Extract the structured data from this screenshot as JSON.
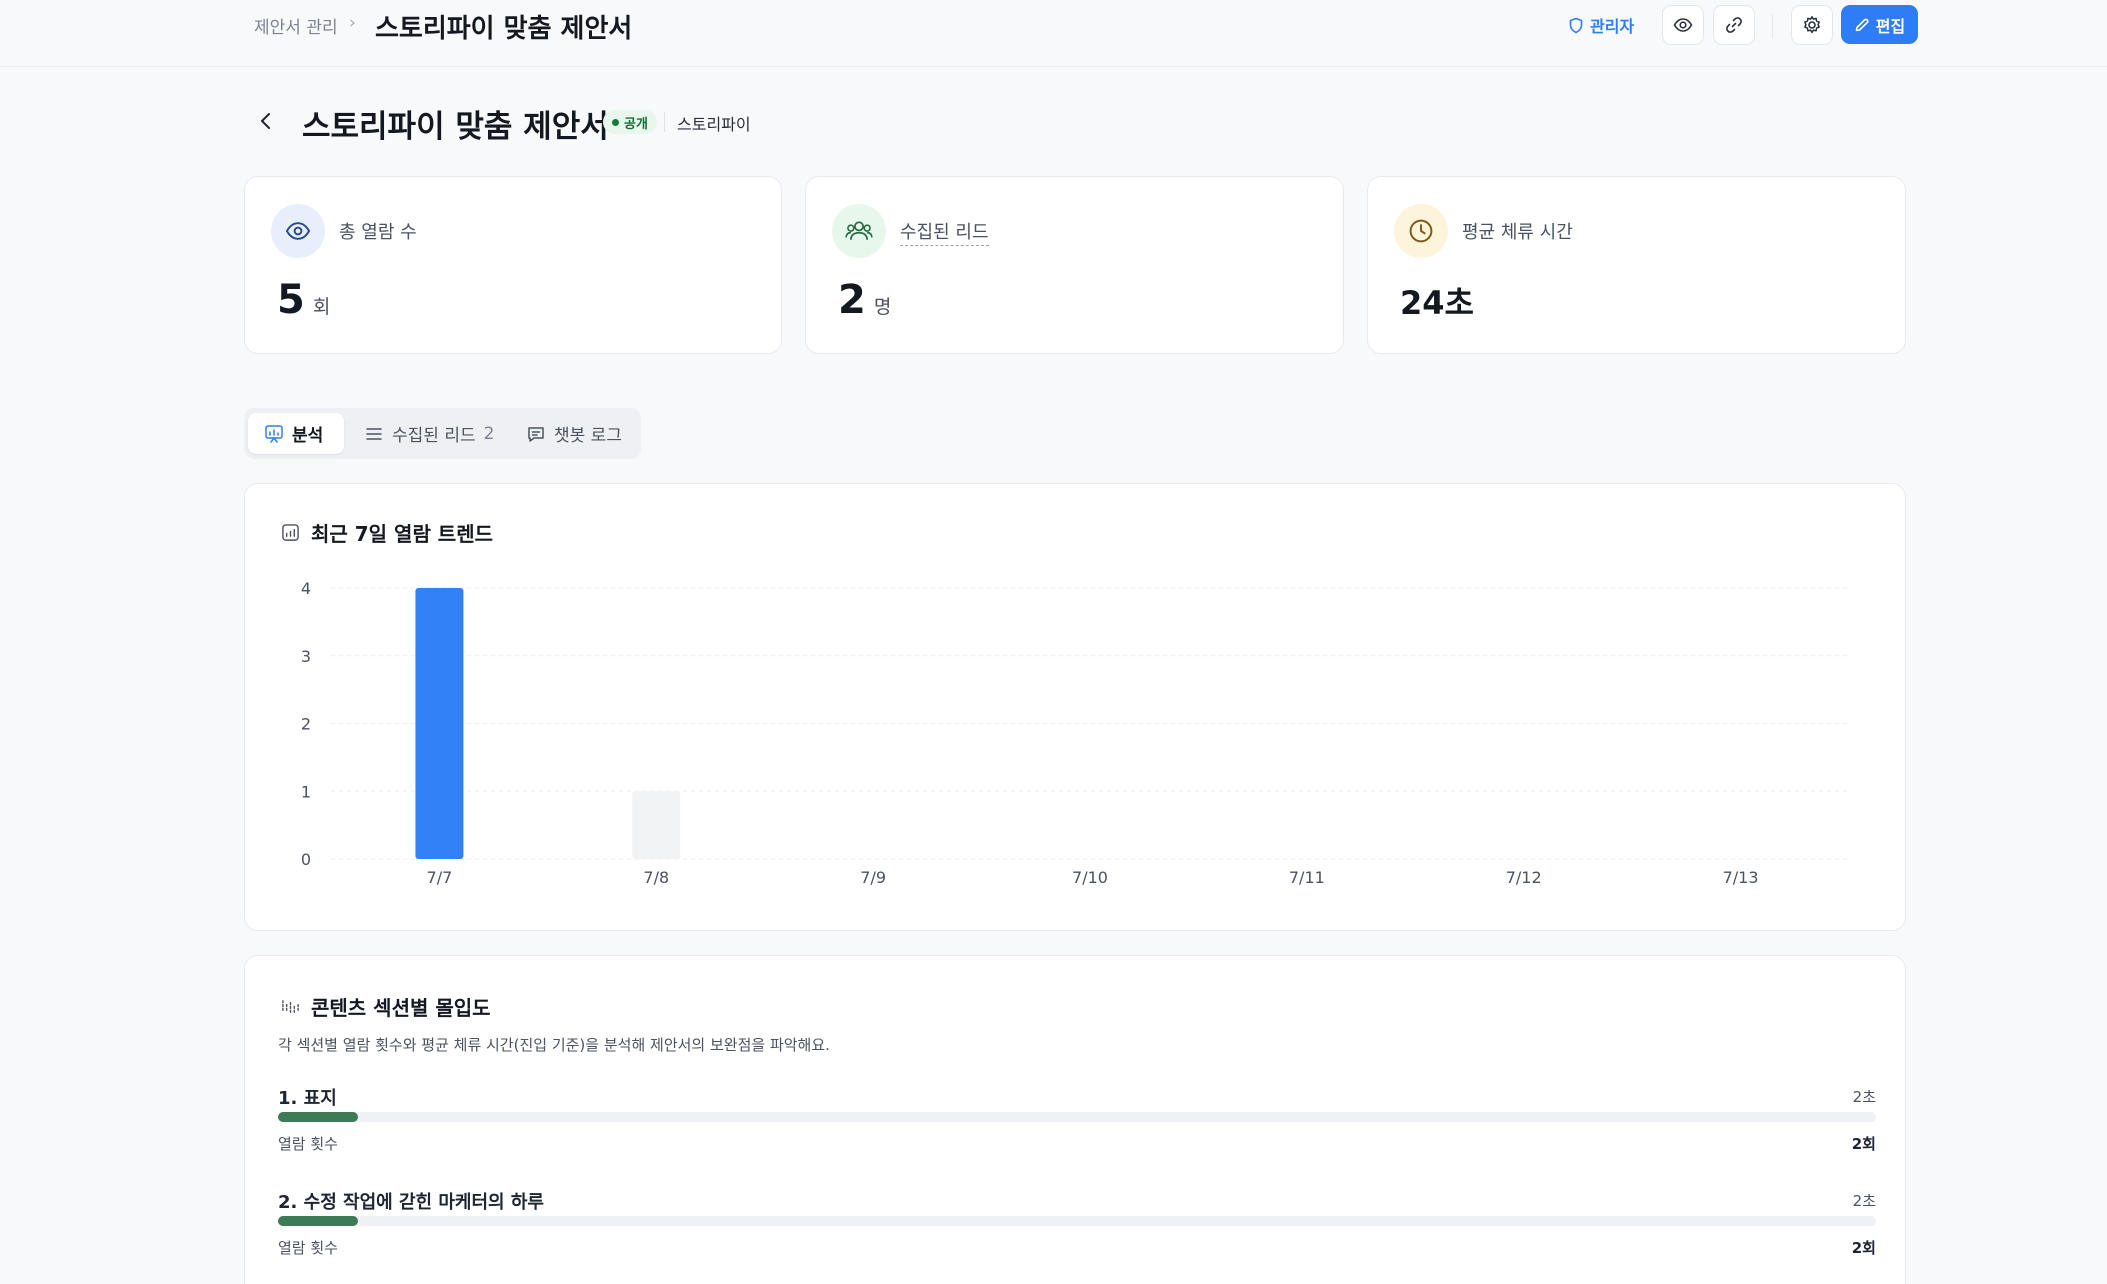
{
  "breadcrumb": {
    "parent": "제안서 관리",
    "separator": "›",
    "current": "스토리파이 맞춤 제안서"
  },
  "header_actions": {
    "admin_label": "관리자",
    "edit_label": "편집"
  },
  "page": {
    "title": "스토리파이 맞춤 제안서",
    "status_badge": "공개",
    "company": "스토리파이"
  },
  "stats": [
    {
      "label": "총 열람 수",
      "value": "5",
      "unit": "회",
      "icon": "eye-icon"
    },
    {
      "label": "수집된 리드",
      "value": "2",
      "unit": "명",
      "icon": "users-icon"
    },
    {
      "label": "평균 체류 시간",
      "value": "24초",
      "icon": "clock-icon"
    }
  ],
  "tabs": [
    {
      "label": "분석",
      "icon": "chart-icon",
      "active": true
    },
    {
      "label": "수집된 리드",
      "count": "2",
      "icon": "list-icon"
    },
    {
      "label": "챗봇 로그",
      "icon": "chat-icon"
    }
  ],
  "trend": {
    "title": "최근 7일 열람 트렌드"
  },
  "chart_data": {
    "type": "bar",
    "categories": [
      "7/7",
      "7/8",
      "7/9",
      "7/10",
      "7/11",
      "7/12",
      "7/13"
    ],
    "values": [
      4,
      1,
      0,
      0,
      0,
      0,
      0
    ],
    "yticks": [
      0,
      1,
      2,
      3,
      4
    ],
    "ylim": [
      0,
      4
    ],
    "grid": true,
    "colors": {
      "highlight": "#3182f6",
      "default": "#f2f3f5"
    }
  },
  "engagement": {
    "title": "콘텐츠 섹션별 몰입도",
    "description": "각 섹션별 열람 횟수와 평균 체류 시간(진입 기준)을 분석해 제안서의 보완점을 파악해요.",
    "sections": [
      {
        "name": "1. 표지",
        "time": "2초",
        "views_label": "열람 횟수",
        "views": "2회",
        "level": 0.05
      },
      {
        "name": "2. 수정 작업에 갇힌 마케터의 하루",
        "time": "2초",
        "views_label": "열람 횟수",
        "views": "2회",
        "level": 0.05
      }
    ]
  },
  "colors": {
    "accent": "#2f7df6",
    "progress": "#3d7a55",
    "badge_bg": "#e7f7ec"
  }
}
